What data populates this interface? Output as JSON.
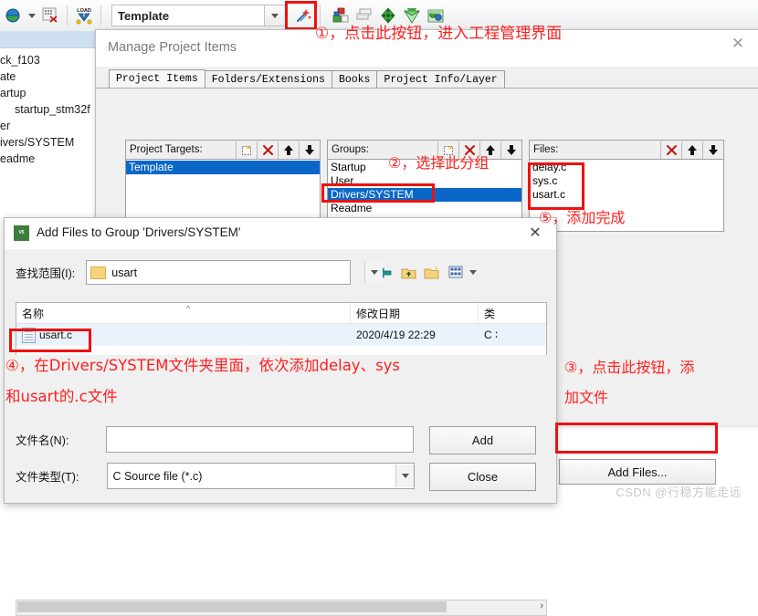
{
  "ide": {
    "toolbar": {
      "target_value": "Template",
      "icons": [
        {
          "name": "download-flash-icon",
          "glyph": "LOAD"
        },
        {
          "name": "build-target-icon",
          "glyph": "▦"
        },
        {
          "name": "dropdown-chevron-icon",
          "glyph": "▾"
        },
        {
          "name": "configure-wizard-icon",
          "glyph": "⚒"
        },
        {
          "name": "manage-project-items-icon",
          "glyph": "■"
        },
        {
          "name": "batch-build-icon",
          "glyph": "▣"
        },
        {
          "name": "pack-installer-icon",
          "glyph": "◆"
        },
        {
          "name": "manage-run-time-icon",
          "glyph": "◇"
        },
        {
          "name": "multi-project-icon",
          "glyph": "◈"
        }
      ]
    },
    "project_tree": [
      {
        "label": "ck_f103",
        "indent": false
      },
      {
        "label": "ate",
        "indent": false
      },
      {
        "label": "artup",
        "indent": false
      },
      {
        "label": "startup_stm32f",
        "indent": true
      },
      {
        "label": "er",
        "indent": false
      },
      {
        "label": "ivers/SYSTEM",
        "indent": false
      },
      {
        "label": "eadme",
        "indent": false
      }
    ]
  },
  "manage_dialog": {
    "title": "Manage Project Items",
    "close_label": "✕",
    "tabs": [
      {
        "label": "Project Items",
        "active": true
      },
      {
        "label": "Folders/Extensions",
        "active": false
      },
      {
        "label": "Books",
        "active": false
      },
      {
        "label": "Project Info/Layer",
        "active": false
      }
    ],
    "targets_panel": {
      "header": "Project Targets:",
      "buttons": [
        {
          "name": "new-target-button",
          "glyph": "⬚"
        },
        {
          "name": "delete-target-button",
          "glyph": "✕"
        },
        {
          "name": "move-up-button",
          "glyph": "⬆"
        },
        {
          "name": "move-down-button",
          "glyph": "⬇"
        }
      ],
      "items": [
        {
          "label": "Template",
          "selected": true
        }
      ]
    },
    "groups_panel": {
      "header": "Groups:",
      "buttons": [
        {
          "name": "new-group-button",
          "glyph": "⬚"
        },
        {
          "name": "delete-group-button",
          "glyph": "✕"
        },
        {
          "name": "move-up-button",
          "glyph": "⬆"
        },
        {
          "name": "move-down-button",
          "glyph": "⬇"
        }
      ],
      "items": [
        {
          "label": "Startup",
          "selected": false
        },
        {
          "label": "User",
          "selected": false
        },
        {
          "label": "Drivers/SYSTEM",
          "selected": true
        },
        {
          "label": "Readme",
          "selected": false
        }
      ]
    },
    "files_panel": {
      "header": "Files:",
      "buttons": [
        {
          "name": "delete-file-button",
          "glyph": "✕"
        },
        {
          "name": "move-up-button",
          "glyph": "⬆"
        },
        {
          "name": "move-down-button",
          "glyph": "⬇"
        }
      ],
      "items": [
        {
          "label": "delay.c",
          "selected": false
        },
        {
          "label": "sys.c",
          "selected": false
        },
        {
          "label": "usart.c",
          "selected": false
        }
      ]
    },
    "add_files_button": "Add Files..."
  },
  "add_files_dialog": {
    "title": "Add Files to Group 'Drivers/SYSTEM'",
    "close_label": "✕",
    "lookin_label": "查找范围(I):",
    "lookin_value": "usart",
    "nav_icons": [
      {
        "name": "back-arrow-icon",
        "glyph": "⇦"
      },
      {
        "name": "up-folder-icon",
        "glyph": "⬆"
      },
      {
        "name": "new-folder-icon",
        "glyph": "὜0"
      },
      {
        "name": "view-mode-icon",
        "glyph": "▦"
      },
      {
        "name": "view-dropdown-icon",
        "glyph": "▾"
      }
    ],
    "columns": [
      "名称",
      "修改日期",
      "类"
    ],
    "rows": [
      {
        "name": "usart.c",
        "modified": "2020/4/19 22:29",
        "type": "C ∶"
      }
    ],
    "filename_label": "文件名(N):",
    "filename_value": "",
    "filetype_label": "文件类型(T):",
    "filetype_value": "C Source file (*.c)",
    "add_button": "Add",
    "close_button": "Close"
  },
  "annotations": [
    {
      "id": "step1",
      "text": "①，点击此按钮，进入工程管理界面"
    },
    {
      "id": "step2",
      "text": "②，选择此分组"
    },
    {
      "id": "step3_line1",
      "text": "③，点击此按钮，添"
    },
    {
      "id": "step3_line2",
      "text": "加文件"
    },
    {
      "id": "step4_line1",
      "text": "④，在Drivers/SYSTEM文件夹里面，依次添加delay、sys"
    },
    {
      "id": "step4_line2",
      "text": "和usart的.c文件"
    },
    {
      "id": "step5",
      "text": "⑤，添加完成"
    }
  ],
  "watermark": "CSDN @行稳方能走远",
  "colors": {
    "annotation_red": "#ff2020",
    "box_red": "#ee1111",
    "selection_blue": "#0a67c8"
  }
}
